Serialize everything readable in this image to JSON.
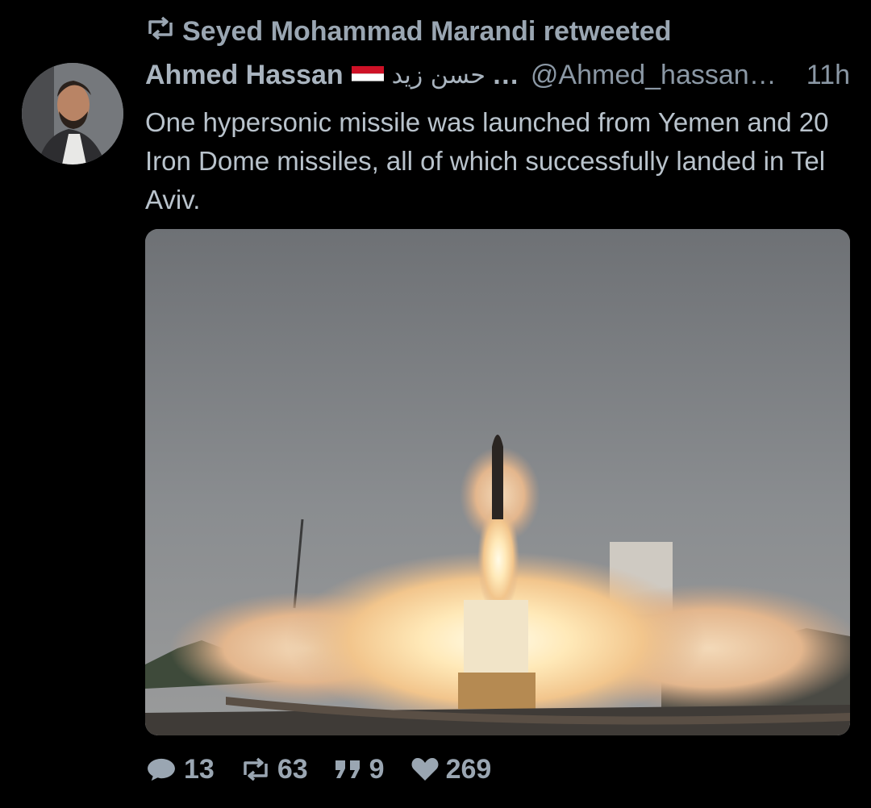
{
  "retweet_notice": {
    "text": "Seyed Mohammad Marandi retweeted",
    "icon": "retweet-icon"
  },
  "tweet": {
    "author_name": "Ahmed Hassan",
    "flag": "yemen-flag",
    "arabic_name": "حسن زيد",
    "ellipsis": "…",
    "handle": "@Ahmed_hassan…",
    "time": "11h",
    "text": "One hypersonic missile was launched from Yemen and 20 Iron Dome missiles, all of which successfully landed in Tel Aviv.",
    "media": "missile-launch-photo"
  },
  "actions": {
    "replies": "13",
    "retweets": "63",
    "quotes": "9",
    "likes": "269"
  },
  "colors": {
    "background": "#000000",
    "text": "#b9c3cc",
    "muted": "#8b98a5"
  }
}
